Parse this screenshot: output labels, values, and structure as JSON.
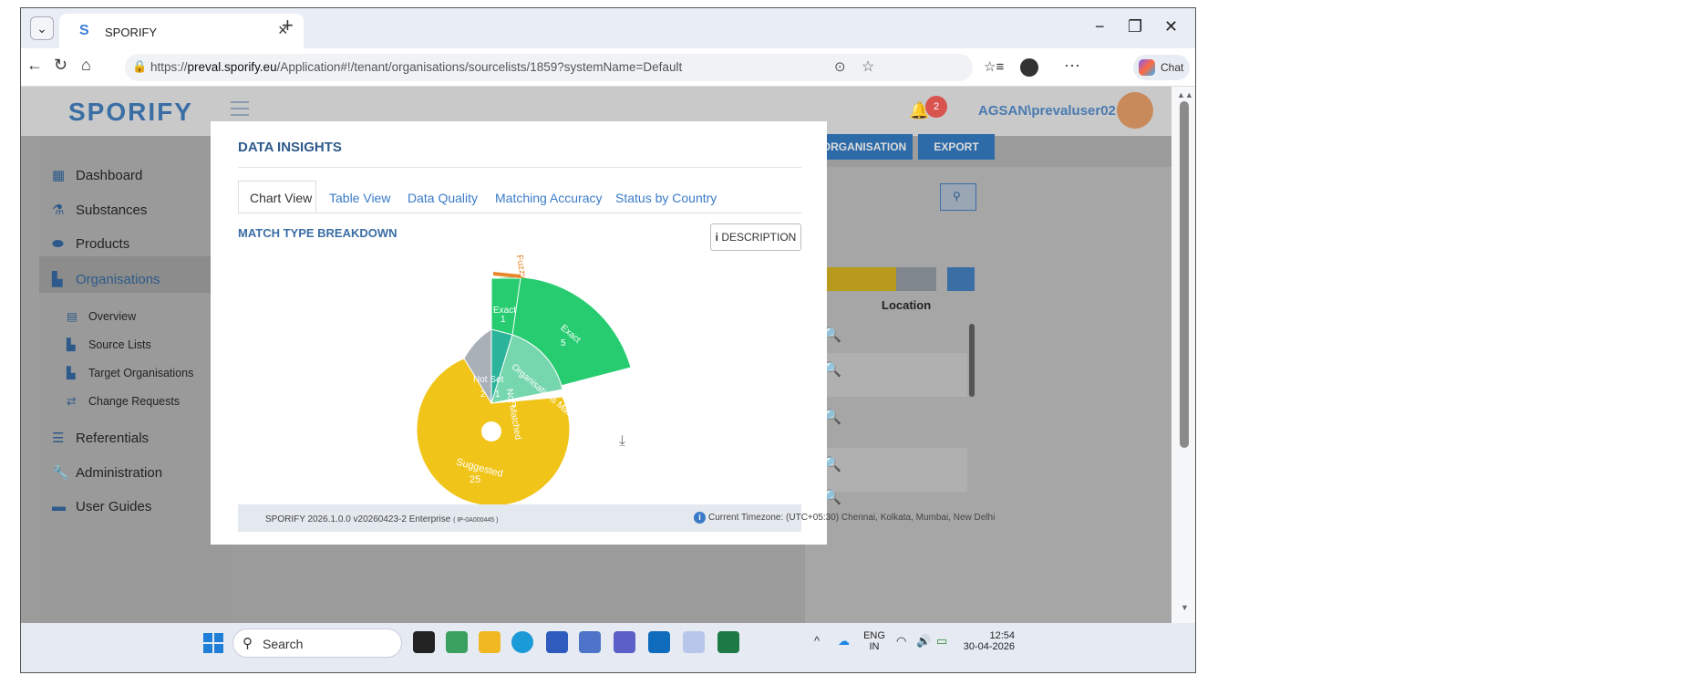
{
  "browser": {
    "tab_logo": "S",
    "tab_title": "SPORIFY",
    "url_prefix": "https://",
    "url_host": "preval.sporify.eu",
    "url_path": "/Application#!/tenant/organisations/sourcelists/1859?systemName=Default",
    "chat_label": "Chat"
  },
  "app": {
    "brand": "SPORIFY",
    "notification_count": "2",
    "user_name": "AGSAN\\prevaluser02",
    "bg_buttons": {
      "organisation": "D ORGANISATION",
      "export": "EXPORT"
    },
    "bg_column_location": "Location"
  },
  "sidebar": {
    "items": [
      {
        "label": "Dashboard",
        "icon": "dashboard-icon"
      },
      {
        "label": "Substances",
        "icon": "flask-icon"
      },
      {
        "label": "Products",
        "icon": "pills-icon"
      },
      {
        "label": "Organisations",
        "icon": "factory-icon"
      },
      {
        "label": "Referentials",
        "icon": "list-icon"
      },
      {
        "label": "Administration",
        "icon": "wrench-icon"
      },
      {
        "label": "User Guides",
        "icon": "book-icon"
      }
    ],
    "sub_items": [
      {
        "label": "Overview",
        "icon": "chart-icon"
      },
      {
        "label": "Source Lists",
        "icon": "factory-icon"
      },
      {
        "label": "Target Organisations",
        "icon": "factory-icon"
      },
      {
        "label": "Change Requests",
        "icon": "arrows-icon"
      }
    ]
  },
  "modal": {
    "title": "DATA INSIGHTS",
    "tabs": [
      "Chart View",
      "Table View",
      "Data Quality",
      "Matching Accuracy",
      "Status by Country"
    ],
    "active_tab": "Chart View",
    "section_title": "MATCH TYPE BREAKDOWN",
    "description_button": "DESCRIPTION",
    "footer_version": "SPORIFY 2026.1.0.0 v20260423-2 Enterprise",
    "footer_ip": "( IP-0A000445 )",
    "footer_timezone": "Current Timezone: (UTC+05:30) Chennai, Kolkata, Mumbai, New Delhi"
  },
  "chart_data": {
    "type": "sunburst",
    "inner": [
      {
        "name": "Suggested",
        "value": 25,
        "color": "#f0c419"
      },
      {
        "name": "Not Set",
        "value": 2,
        "color": "#a9b0b8"
      },
      {
        "name": "Not Matched",
        "value": 1,
        "color": "#2bb39b"
      },
      {
        "name": "Organisations Matched",
        "value": 5,
        "color": "#76d6ad"
      }
    ],
    "outer": [
      {
        "name": "Exact",
        "value": 1,
        "parent": "Not Matched",
        "color": "#27cc70"
      },
      {
        "name": "Exact",
        "value": 5,
        "parent": "Organisations Matched",
        "color": "#27cc70"
      },
      {
        "name": "Fuzzy",
        "value": 1,
        "parent": "Not Matched",
        "color": "#e8862a"
      }
    ],
    "labels": {
      "suggested": "Suggested",
      "suggested_v": "25",
      "notset": "Not Set",
      "notset_v": "2",
      "notmatched": "Not Matched",
      "notmatched_v": "1",
      "orgmatched": "Organisations Matched",
      "orgmatched_v": "5",
      "exact1": "Exact",
      "exact1_v": "1",
      "exact5": "Exact",
      "exact5_v": "5",
      "fuzzy": "Fuzzy",
      "fuzzy_v": "1"
    }
  },
  "taskbar": {
    "search_placeholder": "Search",
    "lang_top": "ENG",
    "lang_bottom": "IN",
    "time": "12:54",
    "date": "30-04-2026"
  }
}
